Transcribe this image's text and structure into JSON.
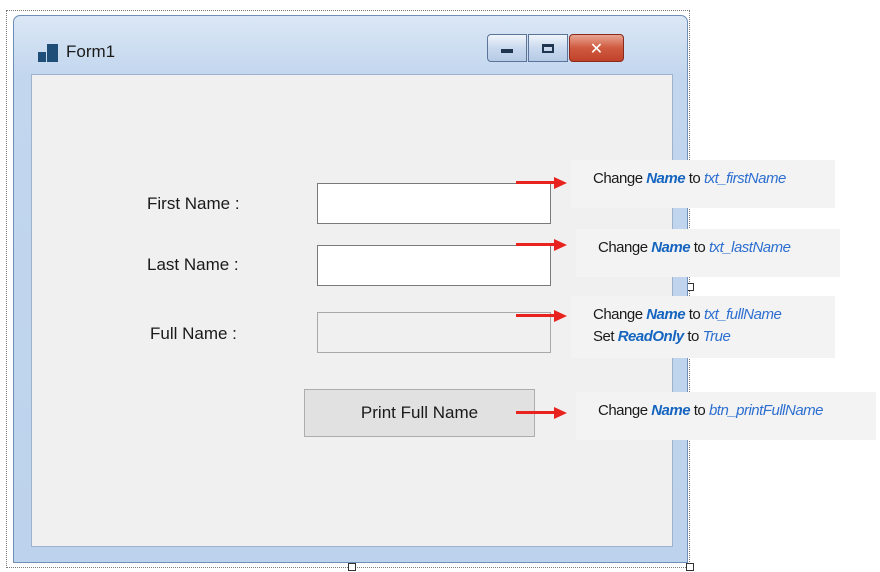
{
  "window": {
    "title": "Form1",
    "controls": {
      "minimize": "minimize",
      "maximize": "maximize",
      "close": "✕"
    }
  },
  "form": {
    "first_name_label": "First Name :",
    "last_name_label": "Last Name :",
    "full_name_label": "Full Name :",
    "first_name_value": "",
    "last_name_value": "",
    "full_name_value": "",
    "print_button_label": "Print Full Name"
  },
  "annotations": {
    "first": {
      "prefix": "Change",
      "keyword": "Name",
      "to": "to",
      "value": "txt_firstName"
    },
    "last": {
      "prefix": "Change",
      "keyword": "Name",
      "to": "to",
      "value": "txt_lastName"
    },
    "full": {
      "prefix": "Change",
      "keyword": "Name",
      "to": "to",
      "value": "txt_fullName",
      "prefix2": "Set",
      "keyword2": "ReadOnly",
      "to2": "to",
      "value2": "True"
    },
    "button": {
      "prefix": "Change",
      "keyword": "Name",
      "to": "to",
      "value": "btn_printFullName"
    }
  },
  "colors": {
    "arrow": "#e8231f",
    "keyword": "#1565c0",
    "value": "#2d6fd0",
    "close_button": "#c1412a"
  }
}
